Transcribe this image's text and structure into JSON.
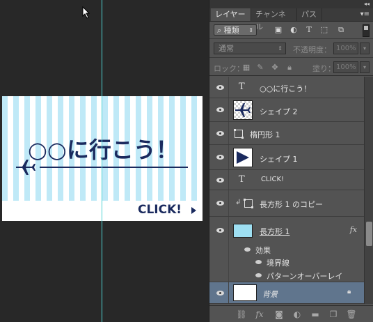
{
  "canvas": {
    "headline": "○○に行こう！",
    "cta": "CLICK!",
    "colors": {
      "stripe": "#bfe9f7",
      "navy": "#1a2a5e",
      "guide": "#4fd3d3"
    }
  },
  "panel": {
    "tabs": [
      "レイヤー",
      "チャンネル",
      "パス"
    ],
    "filter_kind": "種類",
    "blend_mode": "通常",
    "opacity_label": "不透明度：",
    "opacity_value": "100%",
    "lock_label": "ロック：",
    "fill_label": "塗り：",
    "fill_value": "100%"
  },
  "layers": [
    {
      "name": "○○に行こう！",
      "kind": "text"
    },
    {
      "name": "シェイプ 2",
      "kind": "shape"
    },
    {
      "name": "楕円形 1",
      "kind": "vector"
    },
    {
      "name": "シェイプ 1",
      "kind": "shape"
    },
    {
      "name": "CLICK!",
      "kind": "text"
    },
    {
      "name": "長方形 1 のコピー",
      "kind": "clipped"
    },
    {
      "name": "長方形 1",
      "kind": "rect",
      "fx": "fx"
    },
    {
      "name": "背景",
      "kind": "background"
    }
  ],
  "effects": {
    "label": "効果",
    "items": [
      "境界線",
      "パターンオーバーレイ"
    ]
  }
}
